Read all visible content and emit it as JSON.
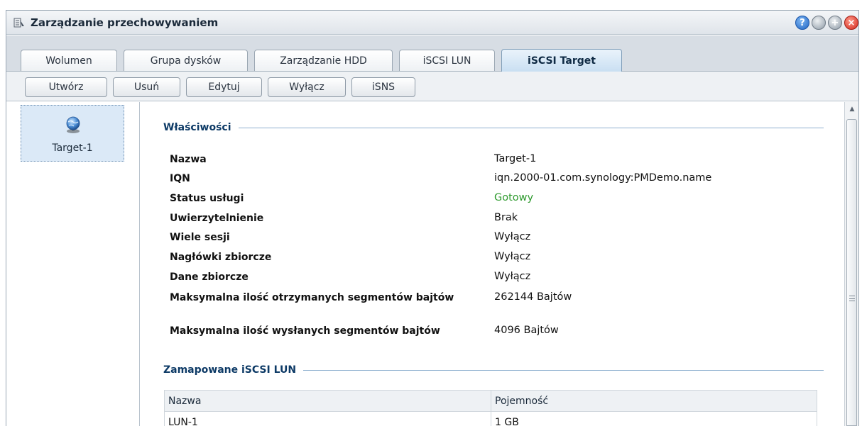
{
  "window": {
    "title": "Zarządzanie przechowywaniem",
    "buttons": [
      "help",
      "minimize",
      "maximize",
      "close"
    ]
  },
  "tabs": [
    {
      "label": "Wolumen",
      "active": false
    },
    {
      "label": "Grupa dysków",
      "active": false
    },
    {
      "label": "Zarządzanie HDD",
      "active": false
    },
    {
      "label": "iSCSI LUN",
      "active": false
    },
    {
      "label": "iSCSI Target",
      "active": true
    }
  ],
  "toolbar": {
    "create": "Utwórz",
    "delete": "Usuń",
    "edit": "Edytuj",
    "disable": "Wyłącz",
    "isns": "iSNS"
  },
  "targets": [
    {
      "name": "Target-1",
      "icon": "globe-icon",
      "selected": true
    }
  ],
  "properties": {
    "section_title": "Właściwości",
    "rows": [
      {
        "label": "Nazwa",
        "value": "Target-1"
      },
      {
        "label": "IQN",
        "value": "iqn.2000-01.com.synology:PMDemo.name"
      },
      {
        "label": "Status usługi",
        "value": "Gotowy",
        "status_color": "#2e9a2e"
      },
      {
        "label": "Uwierzytelnienie",
        "value": "Brak"
      },
      {
        "label": "Wiele sesji",
        "value": "Wyłącz"
      },
      {
        "label": "Nagłówki zbiorcze",
        "value": "Wyłącz"
      },
      {
        "label": "Dane zbiorcze",
        "value": "Wyłącz"
      },
      {
        "label": "Maksymalna ilość otrzymanych segmentów bajtów",
        "value": "262144 Bajtów"
      },
      {
        "label": "Maksymalna ilość wysłanych segmentów bajtów",
        "value": "4096 Bajtów"
      }
    ]
  },
  "mapped_luns": {
    "section_title": "Zamapowane iSCSI LUN",
    "columns": [
      "Nazwa",
      "Pojemność"
    ],
    "rows": [
      [
        "LUN-1",
        "1 GB"
      ]
    ]
  },
  "colors": {
    "accent": "#0d3a66",
    "status_ok": "#2e9a2e",
    "selection": "#dbe9f7"
  }
}
